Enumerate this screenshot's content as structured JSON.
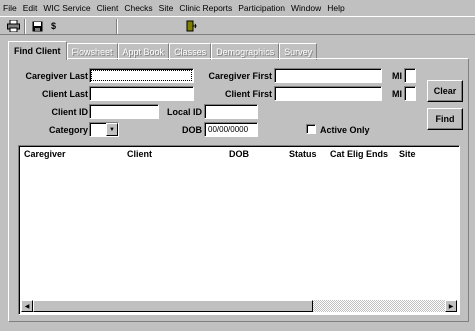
{
  "menu": [
    "File",
    "Edit",
    "WIC Service",
    "Client",
    "Checks",
    "Site",
    "Clinic Reports",
    "Participation",
    "Window",
    "Help"
  ],
  "toolbar": {
    "dollar": "$"
  },
  "tabs": [
    "Find Client",
    "Flowsheet",
    "Appt Book",
    "Classes",
    "Demographics",
    "Survey"
  ],
  "form": {
    "caregiver_last": "Caregiver Last",
    "caregiver_first": "Caregiver First",
    "client_last": "Client Last",
    "client_first": "Client First",
    "mi": "MI",
    "client_id": "Client ID",
    "local_id": "Local ID",
    "category": "Category",
    "dob": "DOB",
    "dob_value": "00/00/0000",
    "active_only": "Active Only"
  },
  "buttons": {
    "clear": "Clear",
    "find": "Find"
  },
  "grid": {
    "columns": [
      "Caregiver",
      "Client",
      "DOB",
      "Status",
      "Cat Elig Ends",
      "Site"
    ]
  }
}
